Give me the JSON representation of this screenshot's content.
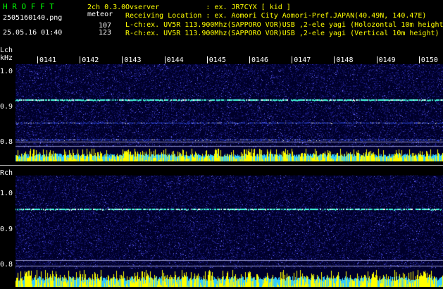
{
  "header": {
    "app_name": "H R O F F T",
    "version": "2ch 0.3.0",
    "filename": "2505160140.png",
    "meteor_label": "meteor",
    "timestamp": "25.05.16 01:40",
    "count_l": "107",
    "count_r": "123",
    "observer_line": "Ovserver           : ex. JR7CYX [ kid ]",
    "location_line": "Receiving Location : ex. Aomori City Aomori-Pref.JAPAN(40.49N, 140.47E)",
    "lch_line": "L-ch:ex. UV5R 113.900Mhz(SAPPORO VOR)USB ,2-ele yagi (Holozontal 10m height)",
    "rch_line": "R-ch:ex. UV5R 113.900Mhz(SAPPORO VOR)USB ,2-ele yagi (Vertical 10m height)"
  },
  "time_ticks": [
    "0141",
    "0142",
    "0143",
    "0144",
    "0145",
    "0146",
    "0147",
    "0148",
    "0149",
    "0150"
  ],
  "lch": {
    "label": "Lch",
    "unit": "kHz",
    "y_labels": [
      "1.0",
      "0.9",
      "0.8"
    ]
  },
  "rch": {
    "label": "Rch",
    "y_labels": [
      "1.0",
      "0.9",
      "0.8"
    ]
  },
  "colors": {
    "background": "#000000",
    "spectrogram_bg": "#00002a",
    "signal_line": "#44ffdd",
    "meteor_bar": "#ffff00",
    "meteor_base": "#33ccff",
    "title": "#00ff00"
  }
}
